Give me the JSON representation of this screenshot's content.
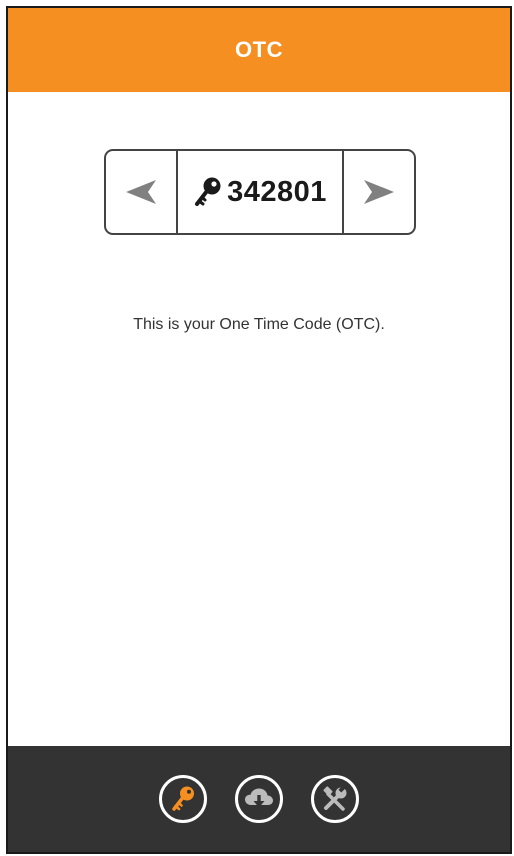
{
  "header": {
    "title": "OTC"
  },
  "otc": {
    "code": "342801",
    "prev_icon": "left-arrow-icon",
    "next_icon": "right-arrow-icon",
    "key_icon": "key-icon"
  },
  "main": {
    "message": "This is your One Time Code (OTC)."
  },
  "tab_bar": {
    "items": [
      {
        "icon": "key-icon",
        "active": true
      },
      {
        "icon": "cloud-download-icon",
        "active": false
      },
      {
        "icon": "tools-icon",
        "active": false
      }
    ]
  },
  "colors": {
    "accent": "#f58f22",
    "bar": "#333333",
    "arrow": "#808080"
  }
}
